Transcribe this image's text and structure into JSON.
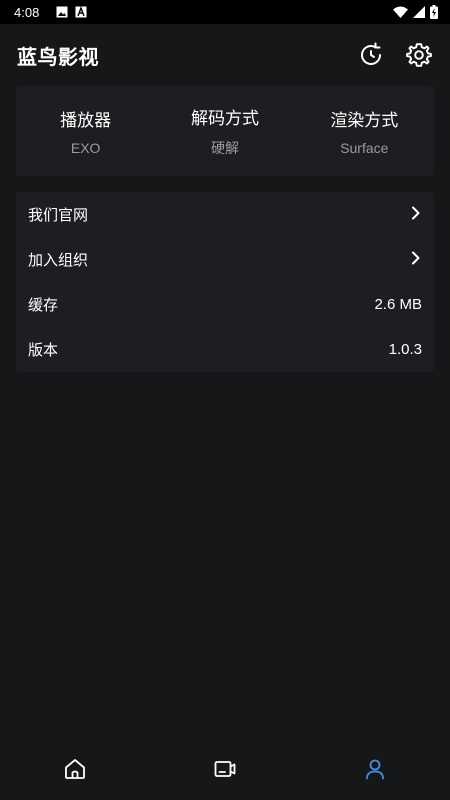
{
  "status_bar": {
    "time": "4:08",
    "icons": [
      "image-icon",
      "a-letter-icon",
      "wifi-icon",
      "signal-icon",
      "battery-charging-icon"
    ]
  },
  "header": {
    "title": "蓝鸟影视",
    "actions": [
      "refresh-icon",
      "gear-icon"
    ]
  },
  "stats": [
    {
      "label": "播放器",
      "value": "EXO"
    },
    {
      "label": "解码方式",
      "value": "硬解"
    },
    {
      "label": "渲染方式",
      "value": "Surface"
    }
  ],
  "menu": {
    "items": [
      {
        "label": "我们官网",
        "value": "",
        "icon": "chevron-right-icon"
      },
      {
        "label": "加入组织",
        "value": "",
        "icon": "chevron-right-icon"
      },
      {
        "label": "缓存",
        "value": "2.6 MB"
      },
      {
        "label": "版本",
        "value": "1.0.3"
      }
    ]
  },
  "bottom_nav": {
    "items": [
      {
        "icon": "home-icon",
        "active": false
      },
      {
        "icon": "tv-icon",
        "active": false
      },
      {
        "icon": "user-icon",
        "active": true
      }
    ],
    "active_color": "#3f8fe0",
    "inactive_color": "#ffffff"
  },
  "colors": {
    "background": "#161719",
    "card": "#1d1e21",
    "secondary_text": "#9a9b9e"
  }
}
